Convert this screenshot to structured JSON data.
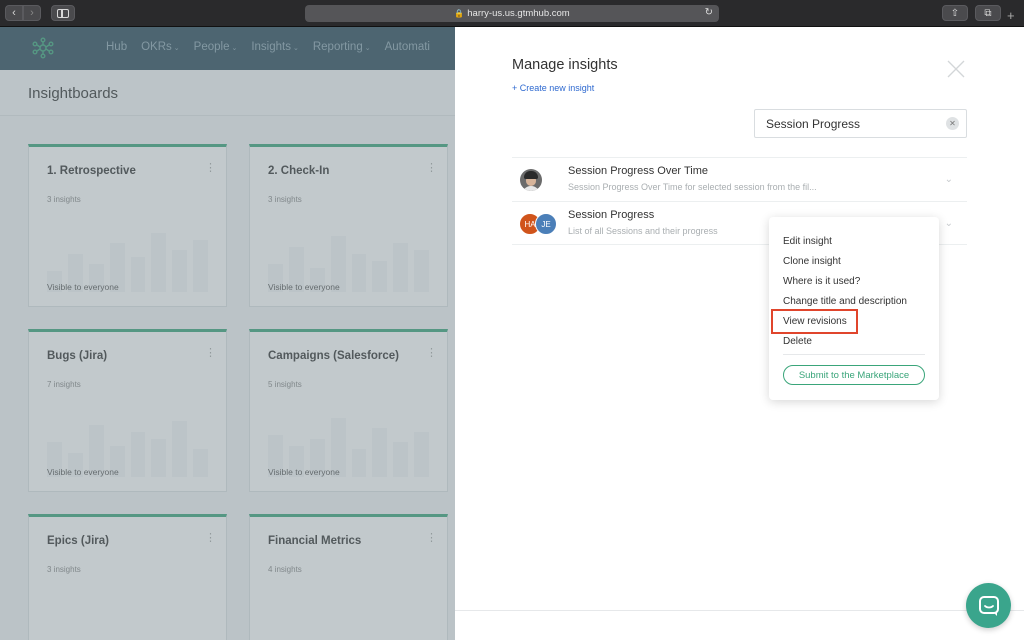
{
  "browser": {
    "url": "harry-us.us.gtmhub.com"
  },
  "app": {
    "nav": [
      "Hub",
      "OKRs",
      "People",
      "Insights",
      "Reporting",
      "Automati"
    ],
    "page_title": "Insightboards",
    "boards": [
      {
        "title": "1. Retrospective",
        "count": "3 insights",
        "visibility": "Visible to everyone"
      },
      {
        "title": "2. Check-In",
        "count": "3 insights",
        "visibility": "Visible to everyone"
      },
      {
        "title": "Bugs (Jira)",
        "count": "7 insights",
        "visibility": "Visible to everyone"
      },
      {
        "title": "Campaigns (Salesforce)",
        "count": "5 insights",
        "visibility": "Visible to everyone"
      },
      {
        "title": "Epics (Jira)",
        "count": "3 insights",
        "visibility": ""
      },
      {
        "title": "Financial Metrics",
        "count": "4 insights",
        "visibility": ""
      }
    ]
  },
  "panel": {
    "title": "Manage insights",
    "create_link": "+ Create new insight",
    "search_value": "Session Progress",
    "insights": [
      {
        "name": "Session Progress Over Time",
        "description": "Session Progress Over Time for selected session from the fil..."
      },
      {
        "name": "Session Progress",
        "description": "List of all Sessions and their progress",
        "owners": [
          "HA",
          "JE"
        ]
      }
    ]
  },
  "menu": {
    "items": [
      "Edit insight",
      "Clone insight",
      "Where is it used?",
      "Change title and description",
      "View revisions",
      "Delete"
    ],
    "highlighted": "View revisions",
    "marketplace_button": "Submit to the Marketplace"
  },
  "colors": {
    "accent_green": "#3aa57a",
    "nav_bg": "#2b4a5a",
    "link_blue": "#2f6ad0",
    "highlight_red": "#e0452c"
  }
}
